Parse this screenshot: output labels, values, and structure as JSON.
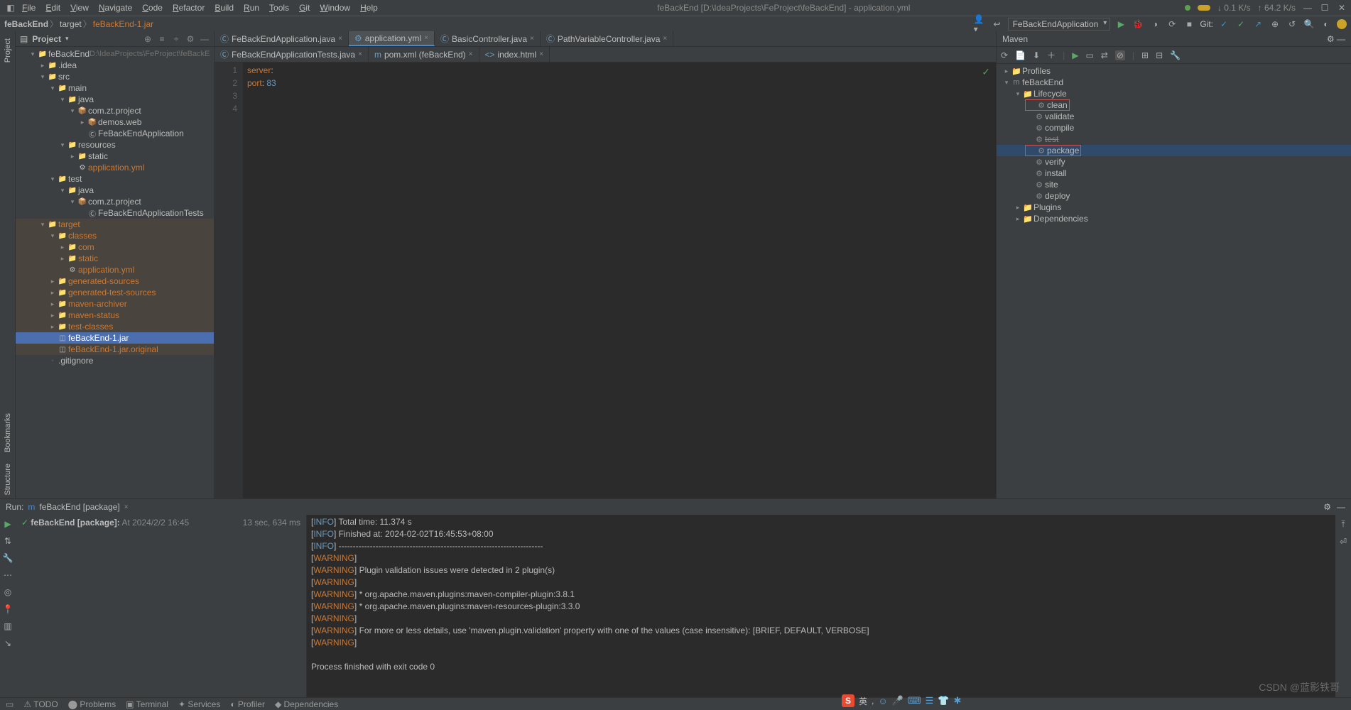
{
  "window": {
    "title": "feBackEnd [D:\\IdeaProjects\\FeProject\\feBackEnd] - application.yml",
    "netDown": "0.1 K/s",
    "netUp": "64.2 K/s"
  },
  "menu": [
    "File",
    "Edit",
    "View",
    "Navigate",
    "Code",
    "Refactor",
    "Build",
    "Run",
    "Tools",
    "Git",
    "Window",
    "Help"
  ],
  "breadcrumbs": {
    "project": "feBackEnd",
    "folder": "target",
    "file": "feBackEnd-1.jar"
  },
  "runConfig": "FeBackEndApplication",
  "gitLabel": "Git:",
  "projectPanel": {
    "title": "Project",
    "root": {
      "name": "feBackEnd",
      "path": "D:\\IdeaProjects\\FeProject\\feBackE"
    },
    "tree": [
      {
        "d": 1,
        "tw": "▾",
        "ico": "📁",
        "lbl": "feBackEnd",
        "extra": "D:\\IdeaProjects\\FeProject\\feBackE",
        "cls": ""
      },
      {
        "d": 2,
        "tw": "▸",
        "ico": "📁",
        "lbl": ".idea",
        "cls": "muted"
      },
      {
        "d": 2,
        "tw": "▾",
        "ico": "📁",
        "lbl": "src",
        "cls": ""
      },
      {
        "d": 3,
        "tw": "▾",
        "ico": "📁",
        "lbl": "main",
        "cls": ""
      },
      {
        "d": 4,
        "tw": "▾",
        "ico": "📁",
        "lbl": "java",
        "cls": "folder-blue"
      },
      {
        "d": 5,
        "tw": "▾",
        "ico": "📦",
        "lbl": "com.zt.project",
        "cls": ""
      },
      {
        "d": 6,
        "tw": "▸",
        "ico": "📦",
        "lbl": "demos.web",
        "cls": ""
      },
      {
        "d": 6,
        "tw": "",
        "ico": "Ⓒ",
        "lbl": "FeBackEndApplication",
        "cls": ""
      },
      {
        "d": 4,
        "tw": "▾",
        "ico": "📁",
        "lbl": "resources",
        "cls": ""
      },
      {
        "d": 5,
        "tw": "▸",
        "ico": "📁",
        "lbl": "static",
        "cls": ""
      },
      {
        "d": 5,
        "tw": "",
        "ico": "⚙",
        "lbl": "application.yml",
        "cls": "file-orange"
      },
      {
        "d": 3,
        "tw": "▾",
        "ico": "📁",
        "lbl": "test",
        "cls": ""
      },
      {
        "d": 4,
        "tw": "▾",
        "ico": "📁",
        "lbl": "java",
        "cls": "folder-blue"
      },
      {
        "d": 5,
        "tw": "▾",
        "ico": "📦",
        "lbl": "com.zt.project",
        "cls": ""
      },
      {
        "d": 6,
        "tw": "",
        "ico": "Ⓒ",
        "lbl": "FeBackEndApplicationTests",
        "cls": ""
      },
      {
        "d": 2,
        "tw": "▾",
        "ico": "📁",
        "lbl": "target",
        "cls": "folder-orange orange-row"
      },
      {
        "d": 3,
        "tw": "▾",
        "ico": "📁",
        "lbl": "classes",
        "cls": "folder-orange orange-row"
      },
      {
        "d": 4,
        "tw": "▸",
        "ico": "📁",
        "lbl": "com",
        "cls": "folder-orange orange-row"
      },
      {
        "d": 4,
        "tw": "▸",
        "ico": "📁",
        "lbl": "static",
        "cls": "folder-orange orange-row"
      },
      {
        "d": 4,
        "tw": "",
        "ico": "⚙",
        "lbl": "application.yml",
        "cls": "file-orange orange-row"
      },
      {
        "d": 3,
        "tw": "▸",
        "ico": "📁",
        "lbl": "generated-sources",
        "cls": "folder-orange orange-row"
      },
      {
        "d": 3,
        "tw": "▸",
        "ico": "📁",
        "lbl": "generated-test-sources",
        "cls": "folder-orange orange-row"
      },
      {
        "d": 3,
        "tw": "▸",
        "ico": "📁",
        "lbl": "maven-archiver",
        "cls": "folder-orange orange-row"
      },
      {
        "d": 3,
        "tw": "▸",
        "ico": "📁",
        "lbl": "maven-status",
        "cls": "folder-orange orange-row"
      },
      {
        "d": 3,
        "tw": "▸",
        "ico": "📁",
        "lbl": "test-classes",
        "cls": "folder-orange orange-row"
      },
      {
        "d": 3,
        "tw": "",
        "ico": "◫",
        "lbl": "feBackEnd-1.jar",
        "cls": "file-orange sel"
      },
      {
        "d": 3,
        "tw": "",
        "ico": "◫",
        "lbl": "feBackEnd-1.jar.original",
        "cls": "file-orange orange-row"
      },
      {
        "d": 2,
        "tw": "",
        "ico": "◦",
        "lbl": ".gitignore",
        "cls": "muted"
      }
    ]
  },
  "editorTabs1": [
    {
      "ico": "Ⓒ",
      "lbl": "FeBackEndApplication.java",
      "active": false
    },
    {
      "ico": "⚙",
      "lbl": "application.yml",
      "active": true
    },
    {
      "ico": "Ⓒ",
      "lbl": "BasicController.java",
      "active": false
    },
    {
      "ico": "Ⓒ",
      "lbl": "PathVariableController.java",
      "active": false
    }
  ],
  "editorTabs2": [
    {
      "ico": "Ⓒ",
      "lbl": "FeBackEndApplicationTests.java",
      "active": false
    },
    {
      "ico": "m",
      "lbl": "pom.xml (feBackEnd)",
      "active": false
    },
    {
      "ico": "<>",
      "lbl": "index.html",
      "active": false
    }
  ],
  "code": {
    "lines": [
      "1",
      "2",
      "3",
      "4"
    ],
    "l1a": "server",
    "l1b": ":",
    "l2a": "  port",
    "l2b": ": ",
    "l2c": "83"
  },
  "mavenPanel": {
    "title": "Maven",
    "tree": [
      {
        "d": 0,
        "tw": "▸",
        "ico": "📁",
        "lbl": "Profiles"
      },
      {
        "d": 0,
        "tw": "▾",
        "ico": "m",
        "lbl": "feBackEnd"
      },
      {
        "d": 1,
        "tw": "▾",
        "ico": "📁",
        "lbl": "Lifecycle"
      },
      {
        "d": 2,
        "tw": "",
        "ico": "⚙",
        "lbl": "clean",
        "red": true
      },
      {
        "d": 2,
        "tw": "",
        "ico": "⚙",
        "lbl": "validate"
      },
      {
        "d": 2,
        "tw": "",
        "ico": "⚙",
        "lbl": "compile"
      },
      {
        "d": 2,
        "tw": "",
        "ico": "⚙",
        "lbl": "test",
        "struck": true
      },
      {
        "d": 2,
        "tw": "",
        "ico": "⚙",
        "lbl": "package",
        "red": true,
        "sel": true
      },
      {
        "d": 2,
        "tw": "",
        "ico": "⚙",
        "lbl": "verify"
      },
      {
        "d": 2,
        "tw": "",
        "ico": "⚙",
        "lbl": "install"
      },
      {
        "d": 2,
        "tw": "",
        "ico": "⚙",
        "lbl": "site"
      },
      {
        "d": 2,
        "tw": "",
        "ico": "⚙",
        "lbl": "deploy"
      },
      {
        "d": 1,
        "tw": "▸",
        "ico": "📁",
        "lbl": "Plugins"
      },
      {
        "d": 1,
        "tw": "▸",
        "ico": "📁",
        "lbl": "Dependencies"
      }
    ]
  },
  "runPanel": {
    "label": "Run:",
    "tab": "feBackEnd [package]",
    "status": "feBackEnd [package]:",
    "statusTime": "At 2024/2/2 16:45",
    "duration": "13 sec, 634 ms",
    "lines": [
      {
        "lvl": "INFO",
        "txt": "] Total time:  11.374 s",
        "cut": true
      },
      {
        "lvl": "INFO",
        "txt": "] Finished at: 2024-02-02T16:45:53+08:00"
      },
      {
        "lvl": "INFO",
        "txt": "] ------------------------------------------------------------------------"
      },
      {
        "lvl": "WARNING",
        "txt": "]"
      },
      {
        "lvl": "WARNING",
        "txt": "] Plugin validation issues were detected in 2 plugin(s)"
      },
      {
        "lvl": "WARNING",
        "txt": "]"
      },
      {
        "lvl": "WARNING",
        "txt": "]  * org.apache.maven.plugins:maven-compiler-plugin:3.8.1"
      },
      {
        "lvl": "WARNING",
        "txt": "]  * org.apache.maven.plugins:maven-resources-plugin:3.3.0"
      },
      {
        "lvl": "WARNING",
        "txt": "]"
      },
      {
        "lvl": "WARNING",
        "txt": "] For more or less details, use 'maven.plugin.validation' property with one of the values (case insensitive): [BRIEF, DEFAULT, VERBOSE]"
      },
      {
        "lvl": "WARNING",
        "txt": "]"
      },
      {
        "lvl": "",
        "txt": ""
      },
      {
        "lvl": "",
        "txt": "Process finished with exit code 0"
      }
    ]
  },
  "sidebars": {
    "left1": "Project",
    "left2": "Bookmarks",
    "left3": "Structure"
  },
  "watermark": "CSDN @蓝影铁哥",
  "ime": "英"
}
